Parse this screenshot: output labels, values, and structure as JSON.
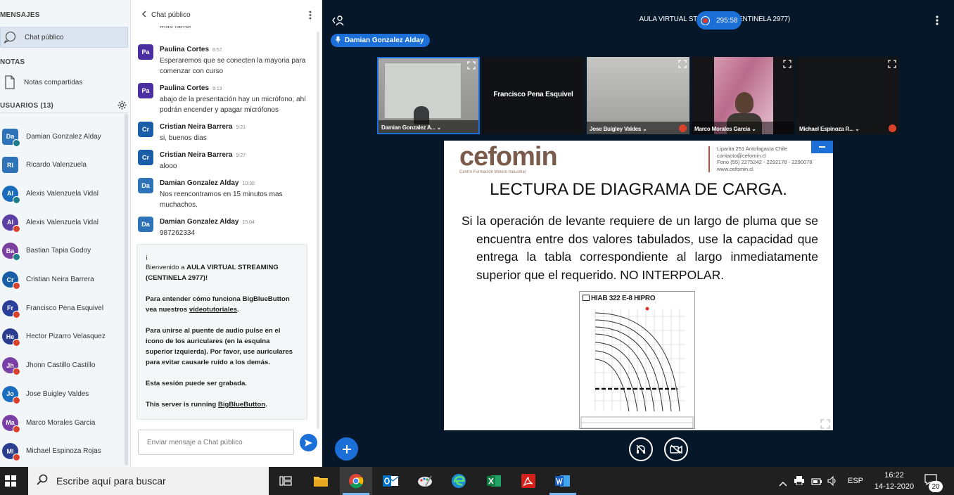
{
  "sidebar": {
    "messages_title": "MENSAJES",
    "public_chat_label": "Chat público",
    "notes_title": "NOTAS",
    "shared_notes_label": "Notas compartidas",
    "users_title": "USUARIOS (13)",
    "users": [
      {
        "initials": "Da",
        "name": "Damian Gonzalez Alday",
        "color": "#2e73b8",
        "square": true,
        "mic": "on"
      },
      {
        "initials": "RI",
        "name": "Ricardo Valenzuela",
        "color": "#2e73b8",
        "square": true,
        "mic": "none"
      },
      {
        "initials": "Al",
        "name": "Alexis Valenzuela Vidal",
        "color": "#1a6dbd",
        "square": false,
        "mic": "on"
      },
      {
        "initials": "Al",
        "name": "Alexis Valenzuela Vidal",
        "color": "#5b3fa3",
        "square": false,
        "mic": "muted"
      },
      {
        "initials": "Ba",
        "name": "Bastian Tapia Godoy",
        "color": "#7b3fa0",
        "square": false,
        "mic": "on"
      },
      {
        "initials": "Cr",
        "name": "Cristian Neira Barrera",
        "color": "#1a5ea8",
        "square": false,
        "mic": "muted"
      },
      {
        "initials": "Fr",
        "name": "Francisco Pena Esquivel",
        "color": "#2a3f99",
        "square": false,
        "mic": "muted"
      },
      {
        "initials": "He",
        "name": "Hector Pizarro Velasquez",
        "color": "#2b3d8f",
        "square": false,
        "mic": "muted"
      },
      {
        "initials": "Jh",
        "name": "Jhonn Castillo Castillo",
        "color": "#7a3fa6",
        "square": false,
        "mic": "muted"
      },
      {
        "initials": "Jo",
        "name": "Jose Buigley Valdes",
        "color": "#1a6dbd",
        "square": false,
        "mic": "muted"
      },
      {
        "initials": "Ma",
        "name": "Marco Morales Garcia",
        "color": "#7a3fa6",
        "square": false,
        "mic": "muted"
      },
      {
        "initials": "MI",
        "name": "Michael Espinoza Rojas",
        "color": "#2b3d8f",
        "square": false,
        "mic": "muted"
      }
    ]
  },
  "chat": {
    "title": "Chat público",
    "truncated_top": "mas tarde",
    "messages": [
      {
        "initials": "Pa",
        "author": "Paulina Cortes",
        "time": "8:57",
        "text": "Esperaremos que se conecten la mayoria para comenzar con curso",
        "color": "#4b2fa0"
      },
      {
        "initials": "Pa",
        "author": "Paulina Cortes",
        "time": "9:13",
        "text": "abajo de la presentación hay un micrófono, ahí podrán encender y apagar micrófonos",
        "color": "#4b2fa0"
      },
      {
        "initials": "Cr",
        "author": "Cristian Neira Barrera",
        "time": "9:21",
        "text": "si, buenos dias",
        "color": "#1a5ea8"
      },
      {
        "initials": "Cr",
        "author": "Cristian Neira Barrera",
        "time": "9:27",
        "text": "alooo",
        "color": "#1a5ea8"
      },
      {
        "initials": "Da",
        "author": "Damian Gonzalez Alday",
        "time": "10:30",
        "text": "Nos reencontramos en 15 minutos mas muchachos.",
        "color": "#2e73b8"
      },
      {
        "initials": "Da",
        "author": "Damian Gonzalez Alday",
        "time": "15:04",
        "text": "987262334",
        "color": "#2e73b8"
      }
    ],
    "welcome": {
      "line0": "¡",
      "p1_a": "Bienvenido a ",
      "p1_b": "AULA VIRTUAL STREAMING (CENTINELA 2977)",
      "p1_c": "!",
      "p2_a": "Para entender cómo funciona BigBlueButton vea nuestros ",
      "p2_link": "vídeotutoriales",
      "p2_c": ".",
      "p3": "Para unirse al puente de audio pulse en el icono de los auriculares (en la esquina superior izquierda). Por favor, use auriculares para evitar causarle ruido a los demás.",
      "p4": "Esta sesión puede ser grabada.",
      "p5_a": "This server is running ",
      "p5_link": "BigBlueButton",
      "p5_c": "."
    },
    "input_placeholder": "Enviar mensaje a Chat público"
  },
  "main": {
    "title": "AULA VIRTUAL STREAMING (CENTINELA 2977)",
    "recording_time": "295:58",
    "presenter": "Damian Gonzalez Alday",
    "cameras": [
      {
        "label": "Damian Gonzalez A..."
      },
      {
        "label": "Francisco Pena Esquivel"
      },
      {
        "label": "Jose Buigley Valdes"
      },
      {
        "label": "Marco Morales Garcia"
      },
      {
        "label": "Michael Espinoza R..."
      }
    ],
    "slide": {
      "logo": "cefomin",
      "logo_sub": "Centro Formación Minero Industrial",
      "addr1": "Liparita 251 Antofagasta Chile",
      "addr2": "contacto@cefomin.cl",
      "addr3": "Fono (55) 2275242 - 2292178 - 2290078",
      "addr4": "www.cefomin.cl",
      "heading": "LECTURA DE DIAGRAMA DE CARGA.",
      "body": "Si la operación de levante requiere de un largo de pluma que se encuentra entre dos valores tabulados, use la capacidad que entrega la tabla correspondiente al largo inmediatamente superior que el requerido. NO INTERPOLAR.",
      "diagram_title": "HIAB 322 E-8 HIPRO"
    }
  },
  "taskbar": {
    "search_placeholder": "Escribe aquí para buscar",
    "lang": "ESP",
    "time": "16:22",
    "date": "14-12-2020",
    "notifications": "20"
  }
}
